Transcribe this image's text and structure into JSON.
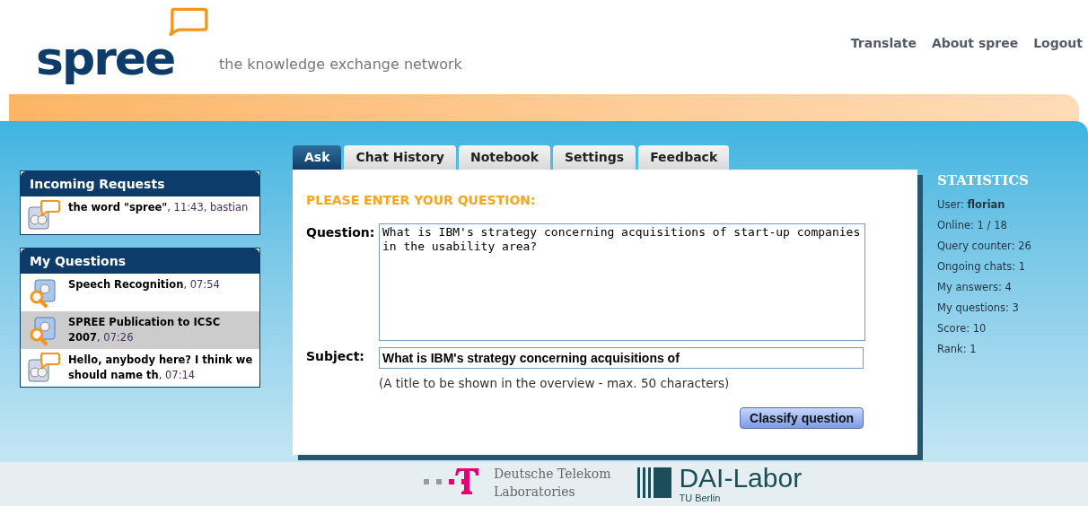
{
  "header": {
    "logo": "spree",
    "tagline": "the knowledge exchange network",
    "links": [
      "Translate",
      "About spree",
      "Logout"
    ]
  },
  "incoming_requests": {
    "title": "Incoming Requests",
    "items": [
      {
        "kind": "chat",
        "text": "**the word \"spree\"**, 11:43, bastian",
        "selected": false
      }
    ]
  },
  "my_questions": {
    "title": "My Questions",
    "items": [
      {
        "kind": "search",
        "text": "**Speech Recognition**, 07:54",
        "selected": false
      },
      {
        "kind": "search",
        "text": "**SPREE Publication to ICSC 2007**, 07:26",
        "selected": true
      },
      {
        "kind": "chat",
        "text": "**Hello, anybody here? I think we should name th**, 07:14",
        "selected": false
      }
    ]
  },
  "tabs": [
    {
      "label": "Ask",
      "selected": true
    },
    {
      "label": "Chat History",
      "selected": false
    },
    {
      "label": "Notebook",
      "selected": false
    },
    {
      "label": "Settings",
      "selected": false
    },
    {
      "label": "Feedback",
      "selected": false
    }
  ],
  "form": {
    "heading": "PLEASE ENTER YOUR QUESTION:",
    "question_label": "Question:",
    "question_value": "What is IBM's strategy concerning acquisitions of start-up companies in the usability area?",
    "subject_label": "Subject:",
    "subject_value": "What is IBM's strategy concerning acquisitions of",
    "subject_hint": "(A title to be shown in the overview - max. 50 characters)",
    "submit": "Classify question"
  },
  "statistics": {
    "title": "STATISTICS",
    "rows": [
      {
        "text": "User: **florian**"
      },
      {
        "text": "Online: 1 / 18"
      },
      {
        "text": "Query counter: 26"
      },
      {
        "text": "Ongoing chats: 1"
      },
      {
        "text": "My answers: 4"
      },
      {
        "text": "My questions: 3"
      },
      {
        "text": "Score: 10"
      },
      {
        "text": "Rank: 1"
      }
    ]
  },
  "footer": {
    "telekom_name": "Deutsche Telekom",
    "telekom_sub": "Laboratories",
    "dai_name": "DAI-Labor",
    "dai_sub": "TU Berlin"
  }
}
